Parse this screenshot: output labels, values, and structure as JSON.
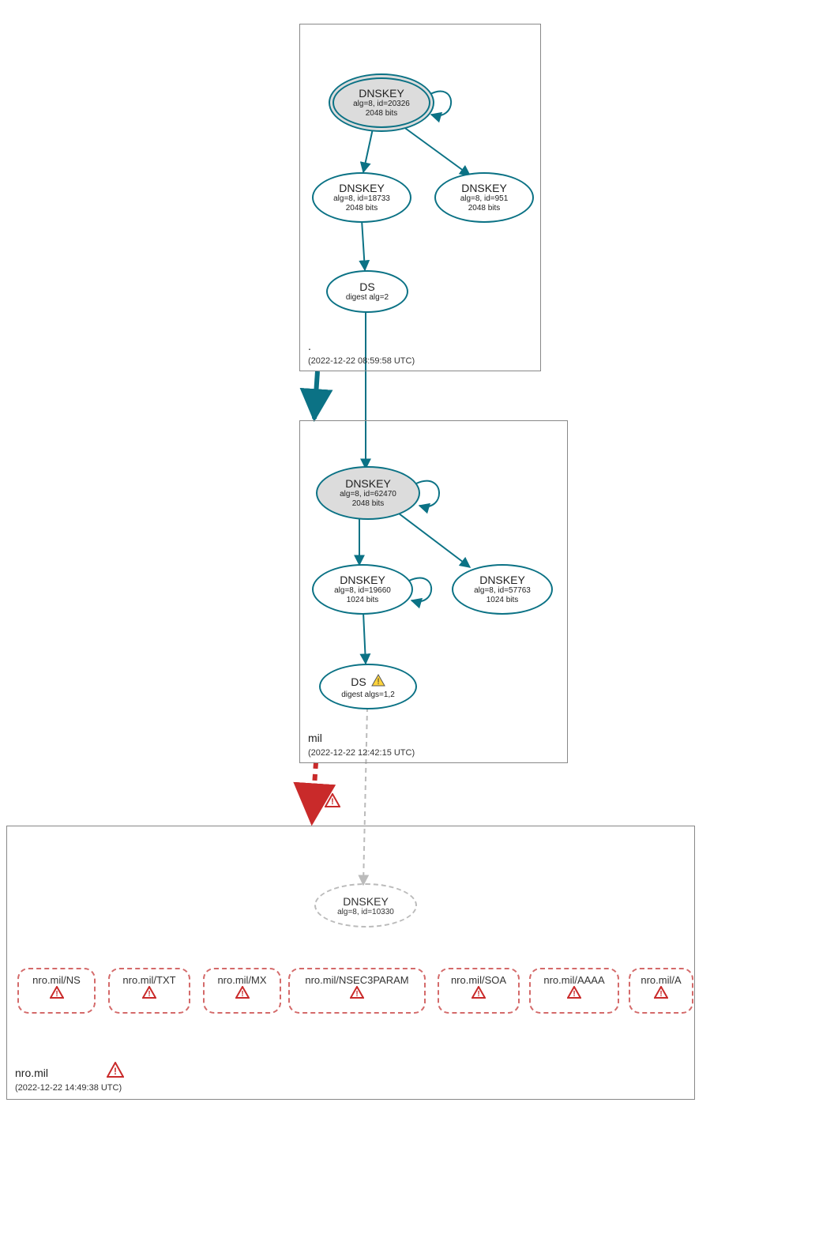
{
  "zones": {
    "root": {
      "name": ".",
      "timestamp": "(2022-12-22 08:59:58 UTC)"
    },
    "mil": {
      "name": "mil",
      "timestamp": "(2022-12-22 12:42:15 UTC)"
    },
    "nro": {
      "name": "nro.mil",
      "timestamp": "(2022-12-22 14:49:38 UTC)"
    }
  },
  "nodes": {
    "root_ksk": {
      "title": "DNSKEY",
      "line1": "alg=8, id=20326",
      "line2": "2048 bits"
    },
    "root_zsk1": {
      "title": "DNSKEY",
      "line1": "alg=8, id=18733",
      "line2": "2048 bits"
    },
    "root_zsk2": {
      "title": "DNSKEY",
      "line1": "alg=8, id=951",
      "line2": "2048 bits"
    },
    "root_ds": {
      "title": "DS",
      "line1": "digest alg=2",
      "line2": ""
    },
    "mil_ksk": {
      "title": "DNSKEY",
      "line1": "alg=8, id=62470",
      "line2": "2048 bits"
    },
    "mil_zsk1": {
      "title": "DNSKEY",
      "line1": "alg=8, id=19660",
      "line2": "1024 bits"
    },
    "mil_zsk2": {
      "title": "DNSKEY",
      "line1": "alg=8, id=57763",
      "line2": "1024 bits"
    },
    "mil_ds": {
      "title": "DS",
      "line1": "digest algs=1,2",
      "line2": ""
    },
    "nro_dnskey": {
      "title": "DNSKEY",
      "line1": "alg=8, id=10330",
      "line2": ""
    }
  },
  "records": {
    "ns": "nro.mil/NS",
    "txt": "nro.mil/TXT",
    "mx": "nro.mil/MX",
    "nsec3": "nro.mil/NSEC3PARAM",
    "soa": "nro.mil/SOA",
    "aaaa": "nro.mil/AAAA",
    "a": "nro.mil/A"
  },
  "colors": {
    "teal": "#0b7285",
    "red": "#c92a2a",
    "gray": "#aaaaaa"
  }
}
